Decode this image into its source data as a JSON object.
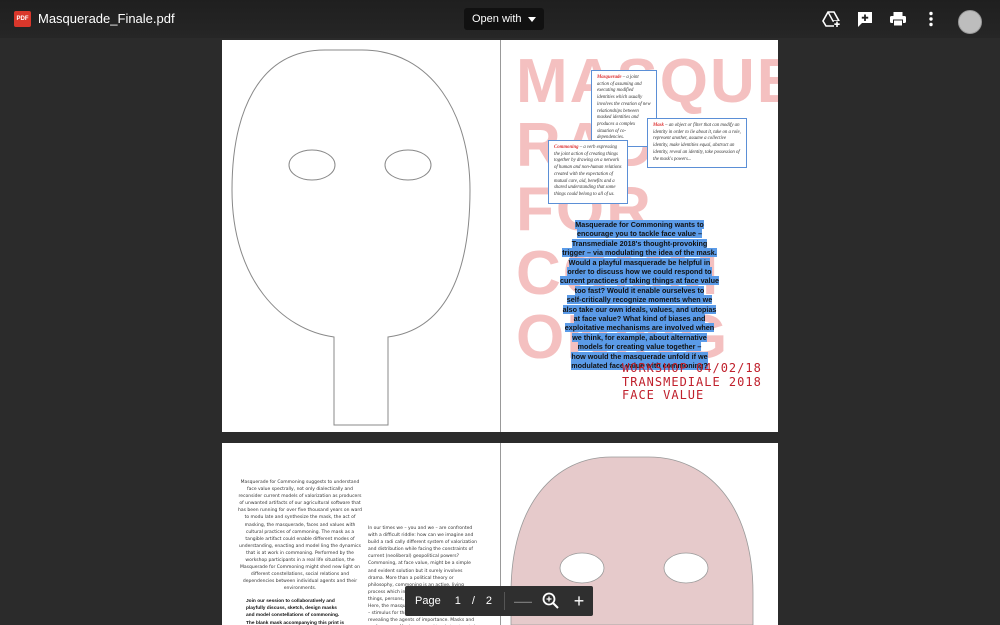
{
  "header": {
    "file_badge": "PDF",
    "file_name": "Masquerade_Finale.pdf",
    "open_with_label": "Open with",
    "icons": [
      "drive-add-icon",
      "add-comment-icon",
      "print-icon",
      "more-vert-icon",
      "avatar"
    ]
  },
  "page1": {
    "big_letters": "MASQUE\nRADE\nFOR\nCOMM\nONING",
    "definitions": {
      "masquerade_term": "Masquerade",
      "masquerade_text": "– a joint action of assuming and executing modified identities which usually involves the creation of new relationships between masked identi­ties and produces a complex situation of co-dependencies.",
      "mask_term": "Mask",
      "mask_text": "– an object or filter that can modify an identity in order to lie about it, take on a role, represent another, assume a collective identity, make identities equal, abstract an identity, reveal an identity, take possession of the mask's powers...",
      "commoning_term": "Commoning",
      "commoning_text": "– a verb expressing the joint action of creating things together by drawing on a network of human and non-human relati­ons created with the expectation of mutual care, aid, benefits and a shared understanding that some things could belong to all of us."
    },
    "intro_lines": [
      "Masquerade for Commoning wants to",
      "encourage you to tackle face value –",
      "Transmediale 2018's thought-provoking",
      "trigger – via modulating the idea of the mask.",
      "Would a playful masquerade be helpful in",
      "order to discuss how we could respond to",
      "current practices of taking things at face value",
      "too fast? Would it enable ourselves to",
      "self-critically recognize moments when we",
      "also take our own ideals, values, and utopias",
      "at face value? What kind of biases and",
      "exploitative mechanisms are involved when",
      "we think, for example, about alternative",
      "models for creating value together –",
      "how would the masquerade unfold if we",
      "modulated face value with commoning?"
    ],
    "workshop_lines": [
      "WORKSHOP 04/02/18",
      "TRANSMEDIALE 2018",
      "FACE VALUE"
    ]
  },
  "page2": {
    "left_text": "Masquerade for Commoning suggests to understand face value spectrally, not only dialectically and reconsider current models of valorization as producers of unwanted artifacts of our agricultural software that has been running for over five thousand years on ward to modu late and synthesize the mask, the act of masking, the masquerade, faces and values with cultural practices of commoning. The mask as a tangible artifact could enable different modes of understanding, enacting and model ling the dynamics that is at work in commoning. Performed by the workshop participants in a real life situation, the Masquerade for Commoning might shed new light on different constellations, social relations and dependencies between individual agents and their environments.",
    "mid_text": "In our times we – you and we – are confronted with a difficult riddle: how can we imagine and build a radi cally different system of valorization and distribution while facing the constraints of current (neoliberal) geopolitical powers? Commoning, at face value, might be a simple and evident solution but it surely involves drama. More than a political theory or philosophy, commoning is an active, living process which involves a complex ecosystem of things, persons, infrastructures, architectures. Here, the masquerade plays a role as a stimulus – stimulus for thinking darkness and even more revealing the agents of importance. Masks and performance. Masks are used to abstract certain aspects",
    "bold_text": "Join our session to collaboratively and playfully discuss, sketch, design masks and model constellations of commoning. The blank mask accompanying this print is"
  },
  "pagebar": {
    "label": "Page",
    "current": "1",
    "separator": "/",
    "total": "2",
    "zoom_out": "—",
    "zoom_in": "+"
  }
}
